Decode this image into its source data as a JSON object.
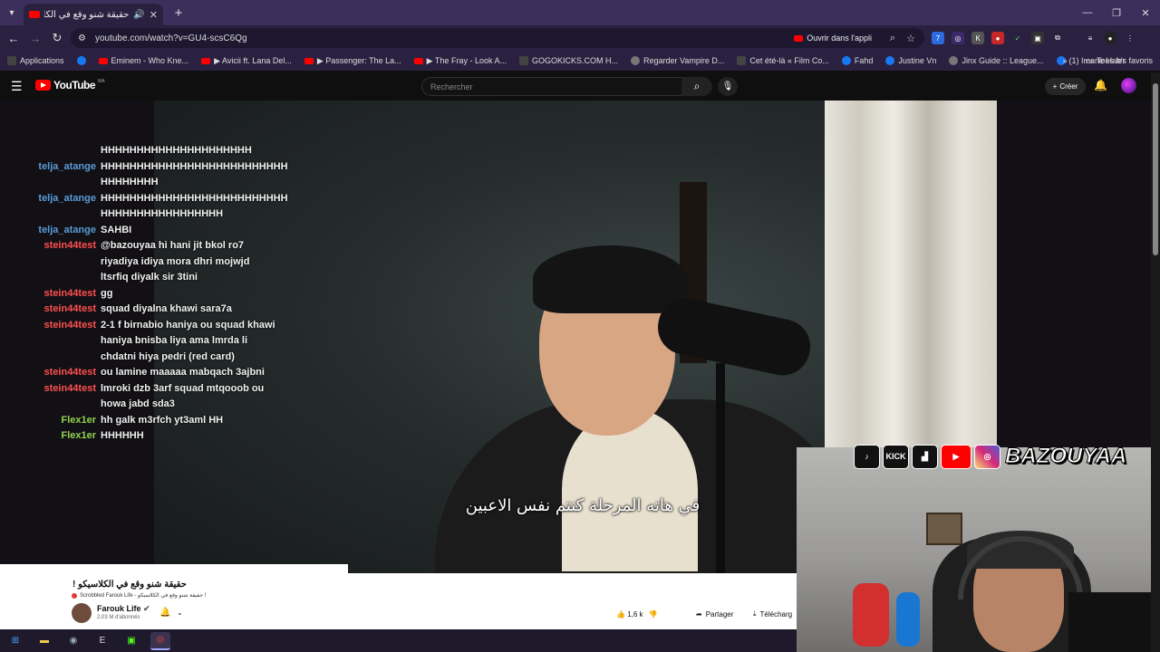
{
  "browser": {
    "tab_title": "حقيقة شنو وقع في الكلاسيكو",
    "new_tab_glyph": "+",
    "url": "youtube.com/watch?v=GU4-scsC6Qg",
    "open_in_app": "Ouvrir dans l'appli",
    "bookmarks": [
      {
        "label": "Applications",
        "icon": "grid-icon",
        "type": "gr"
      },
      {
        "label": "",
        "icon": "facebook-icon",
        "type": "fb"
      },
      {
        "label": "Eminem - Who Kne...",
        "icon": "youtube-icon",
        "type": "yt"
      },
      {
        "label": "▶ Avicii ft. Lana Del...",
        "icon": "youtube-icon",
        "type": "yt"
      },
      {
        "label": "▶ Passenger: The La...",
        "icon": "youtube-icon",
        "type": "yt"
      },
      {
        "label": "▶ The Fray - Look A...",
        "icon": "youtube-icon",
        "type": "yt"
      },
      {
        "label": "GOGOKICKS.COM H...",
        "icon": "site-icon",
        "type": "gr"
      },
      {
        "label": "Regarder Vampire D...",
        "icon": "globe-icon",
        "type": "gl"
      },
      {
        "label": "Cet été-là « Film Co...",
        "icon": "site-icon",
        "type": "gr"
      },
      {
        "label": "Fahd",
        "icon": "facebook-icon",
        "type": "fb"
      },
      {
        "label": "Justine Vn",
        "icon": "facebook-icon",
        "type": "fb"
      },
      {
        "label": "Jinx Guide :: League...",
        "icon": "site-icon",
        "type": "gl"
      },
      {
        "label": "(1) Imane Hab'r",
        "icon": "facebook-icon",
        "type": "fb"
      }
    ],
    "all_favorites": "Tous les favoris"
  },
  "youtube": {
    "logo_text": "YouTube",
    "country_code": "MA",
    "search_placeholder": "Rechercher",
    "create_label": "Créer"
  },
  "chat": [
    {
      "user": "",
      "text": "HHHHHHHHHHHHHHHHHHHHH",
      "color": "u-blue"
    },
    {
      "user": "telja_atange",
      "text": "HHHHHHHHHHHHHHHHHHHHHHHHHH HHHHHHHH",
      "color": "u-blue"
    },
    {
      "user": "telja_atange",
      "text": "HHHHHHHHHHHHHHHHHHHHHHHHHH HHHHHHHHHHHHHHHHH",
      "color": "u-blue"
    },
    {
      "user": "telja_atange",
      "text": "SAHBI",
      "color": "u-blue"
    },
    {
      "user": "stein44test",
      "text": "@bazouyaa hi hani jit bkol ro7 riyadiya idiya mora dhri mojwjd ltsrfiq diyalk sir 3tini",
      "color": "u-red"
    },
    {
      "user": "stein44test",
      "text": "gg",
      "color": "u-red"
    },
    {
      "user": "stein44test",
      "text": "squad diyalna khawi sara7a",
      "color": "u-red"
    },
    {
      "user": "stein44test",
      "text": "2-1 f birnabio haniya ou squad khawi haniya bnisba liya ama lmrda li chdatni hiya pedri (red card)",
      "color": "u-red"
    },
    {
      "user": "stein44test",
      "text": "ou lamine maaaaa mabqach 3ajbni",
      "color": "u-red"
    },
    {
      "user": "stein44test",
      "text": "lmroki dzb 3arf squad mtqooob ou howa jabd sda3",
      "color": "u-red"
    },
    {
      "user": "Flex1er",
      "text": "hh galk m3rfch yt3aml HH",
      "color": "u-green"
    },
    {
      "user": "Flex1er",
      "text": "HHHHHH",
      "color": "u-green"
    }
  ],
  "video": {
    "subtitle": "في هاته المرحلة كنتم نفس الاعبين",
    "title": "حقيقة شنو وقع في الكلاسيكو !",
    "scrobble": "Scrobbled Farouk Life - حقيقة شنو وقع في الكلاسيكو !",
    "channel_name": "Farouk Life",
    "channel_subs": "2,03 M d'abonnés",
    "likes": "1,6 k",
    "share": "Partager",
    "download": "Télécharg"
  },
  "stream": {
    "brand": "BAZOUYAA",
    "socials": [
      "tiktok-icon",
      "kick-icon",
      "twitch-icon",
      "youtube-icon",
      "instagram-icon"
    ]
  },
  "colors": {
    "accent": "#ff0000",
    "browser_frame": "#3c2f5c",
    "chat_blue": "#5a9bd8",
    "chat_red": "#ff4f4f",
    "chat_green": "#8fd14f"
  }
}
